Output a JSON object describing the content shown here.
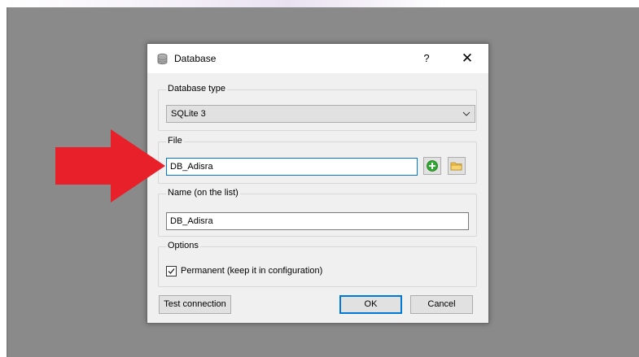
{
  "dialog": {
    "title": "Database",
    "help_label": "?",
    "close_label": "✕",
    "icon": "database-icon"
  },
  "database_type": {
    "label": "Database type",
    "selected": "SQLite 3"
  },
  "file": {
    "label": "File",
    "value": "DB_Adisra"
  },
  "name": {
    "label": "Name (on the list)",
    "value": "DB_Adisra"
  },
  "options": {
    "label": "Options",
    "permanent_label": "Permanent (keep it in configuration)",
    "permanent_checked": true
  },
  "buttons": {
    "test": "Test connection",
    "ok": "OK",
    "cancel": "Cancel"
  },
  "colors": {
    "focus": "#0078d7",
    "arrow": "#e8202a",
    "add_icon": "#2fa82f",
    "folder_icon": "#f3c04e"
  }
}
